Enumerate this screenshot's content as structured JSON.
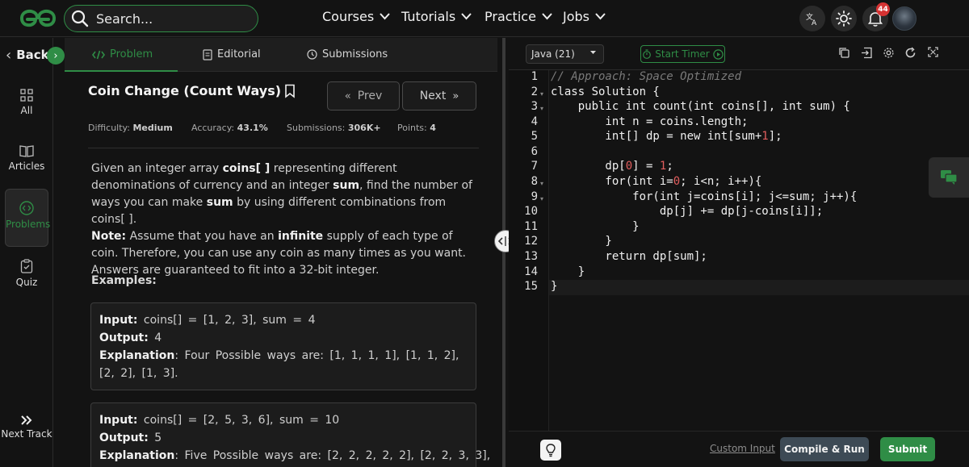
{
  "header": {
    "logo_name": "geeksforgeeks-logo",
    "search_placeholder": "Search...",
    "nav": [
      "Courses",
      "Tutorials",
      "Practice",
      "Jobs"
    ],
    "notifications_count": "44",
    "colors": {
      "accent": "#2f8d46",
      "badge": "#d63333"
    }
  },
  "rail": {
    "back_label": "Back",
    "items": [
      {
        "label": "All",
        "icon": "grid-icon"
      },
      {
        "label": "Articles",
        "icon": "book-icon"
      },
      {
        "label": "Problems",
        "icon": "code-icon"
      },
      {
        "label": "Quiz",
        "icon": "clipboard-icon"
      }
    ],
    "next_track": "Next Track"
  },
  "tabs": [
    "Problem",
    "Editorial",
    "Submissions"
  ],
  "problem": {
    "title": "Coin Change (Count Ways)",
    "prev_label": "Prev",
    "next_label": "Next",
    "meta": {
      "difficulty_label": "Difficulty:",
      "difficulty": "Medium",
      "accuracy_label": "Accuracy:",
      "accuracy": "43.1%",
      "submissions_label": "Submissions:",
      "submissions": "306K+",
      "points_label": "Points:",
      "points": "4"
    },
    "desc": {
      "p1": "Given an integer array",
      "coins": "coins[ ]",
      "p2": "representing different denominations of currency and an integer",
      "sum": "sum",
      "p3": ", find the number of ways you can make",
      "sum2": "sum",
      "p4": "by using different combinations from coins[ ].",
      "note_label": "Note:",
      "n1": "Assume that you have an",
      "infinite": "infinite",
      "n2": "supply of each type of coin. Therefore, you can use any coin as many times as you want.",
      "n3": "Answers are guaranteed to fit into a 32-bit integer."
    },
    "examples_label": "Examples:",
    "examples": [
      {
        "input_label": "Input:",
        "input": "coins[] = [1, 2, 3], sum = 4",
        "output_label": "Output:",
        "output": "4",
        "explanation_label": "Explanation",
        "explanation": ": Four Possible ways are: [1, 1, 1, 1], [1, 1, 2], [2, 2], [1, 3]."
      },
      {
        "input_label": "Input:",
        "input": "coins[] = [2, 5, 3, 6], sum = 10",
        "output_label": "Output:",
        "output": "5",
        "explanation_label": "Explanation",
        "explanation": ": Five Possible ways are: [2, 2, 2, 2, 2], [2, 2, 3, 3],"
      }
    ]
  },
  "editor": {
    "language": "Java (21)",
    "timer_label": "Start Timer",
    "line_numbers": [
      "1",
      "2",
      "3",
      "4",
      "5",
      "6",
      "7",
      "8",
      "9",
      "10",
      "11",
      "12",
      "13",
      "14",
      "15"
    ],
    "lines": {
      "l1": "// Approach: Space Optimized",
      "l2": "class Solution {",
      "l3": "    public int count(int coins[], int sum) {",
      "l4": "        int n = coins.length;",
      "l5a": "        int[] dp = new int[sum+",
      "l5b": "1",
      "l5c": "];",
      "l7a": "        dp[",
      "l7b": "0",
      "l7c": "] = ",
      "l7d": "1",
      "l7e": ";",
      "l8a": "        for(int i=",
      "l8b": "0",
      "l8c": "; i<n; i++){",
      "l9": "            for(int j=coins[i]; j<=sum; j++){",
      "l10": "                dp[j] += dp[j-coins[i]];",
      "l11": "            }",
      "l12": "        }",
      "l13": "        return dp[sum];",
      "l14": "    }",
      "l15": "}"
    }
  },
  "footer": {
    "custom_input": "Custom Input",
    "compile_label": "Compile & Run",
    "submit_label": "Submit"
  }
}
